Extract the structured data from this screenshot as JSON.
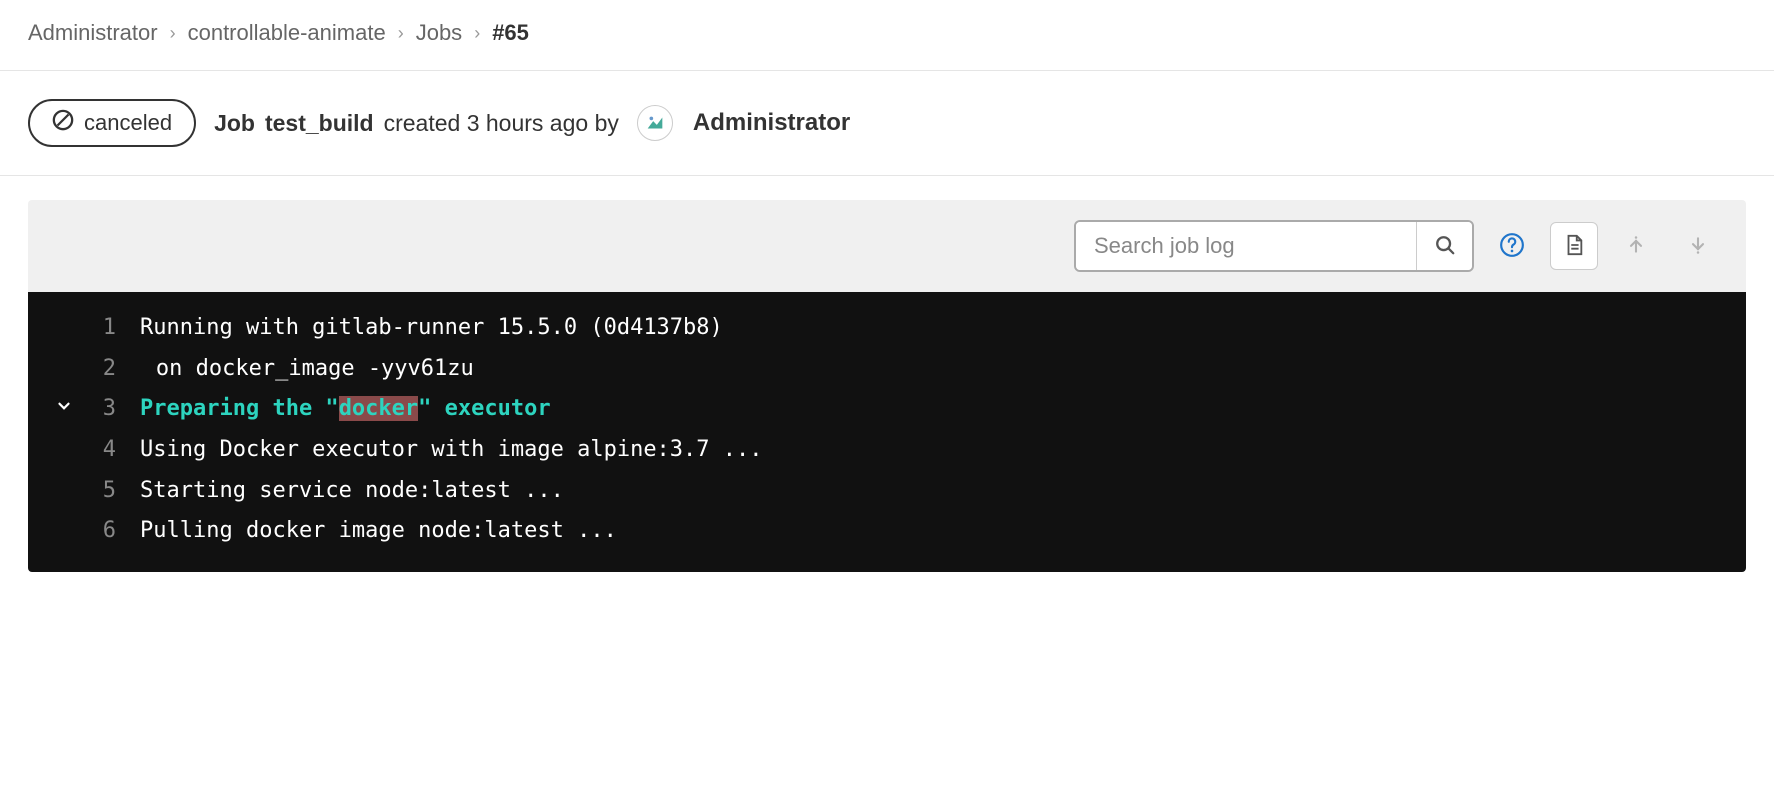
{
  "breadcrumb": {
    "items": [
      "Administrator",
      "controllable-animate",
      "Jobs"
    ],
    "current": "#65"
  },
  "status": {
    "label": "canceled"
  },
  "job": {
    "prefix": "Job",
    "name": "test_build",
    "created_text": "created 3 hours ago by",
    "author": "Administrator"
  },
  "search": {
    "placeholder": "Search job log",
    "value": ""
  },
  "log": {
    "lines": [
      {
        "n": "1",
        "text": "Running with gitlab-runner 15.5.0 (0d4137b8)",
        "collapsible": false,
        "indent": false
      },
      {
        "n": "2",
        "text": "on docker_image -yyv61zu",
        "collapsible": false,
        "indent": true
      },
      {
        "n": "3",
        "pre": "Preparing the \"",
        "hl": "docker",
        "post": "\" executor",
        "collapsible": true,
        "section": true,
        "indent": false
      },
      {
        "n": "4",
        "text": "Using Docker executor with image alpine:3.7 ...",
        "collapsible": false,
        "indent": false
      },
      {
        "n": "5",
        "text": "Starting service node:latest ...",
        "collapsible": false,
        "indent": false
      },
      {
        "n": "6",
        "text": "Pulling docker image node:latest ...",
        "collapsible": false,
        "indent": false
      }
    ]
  }
}
